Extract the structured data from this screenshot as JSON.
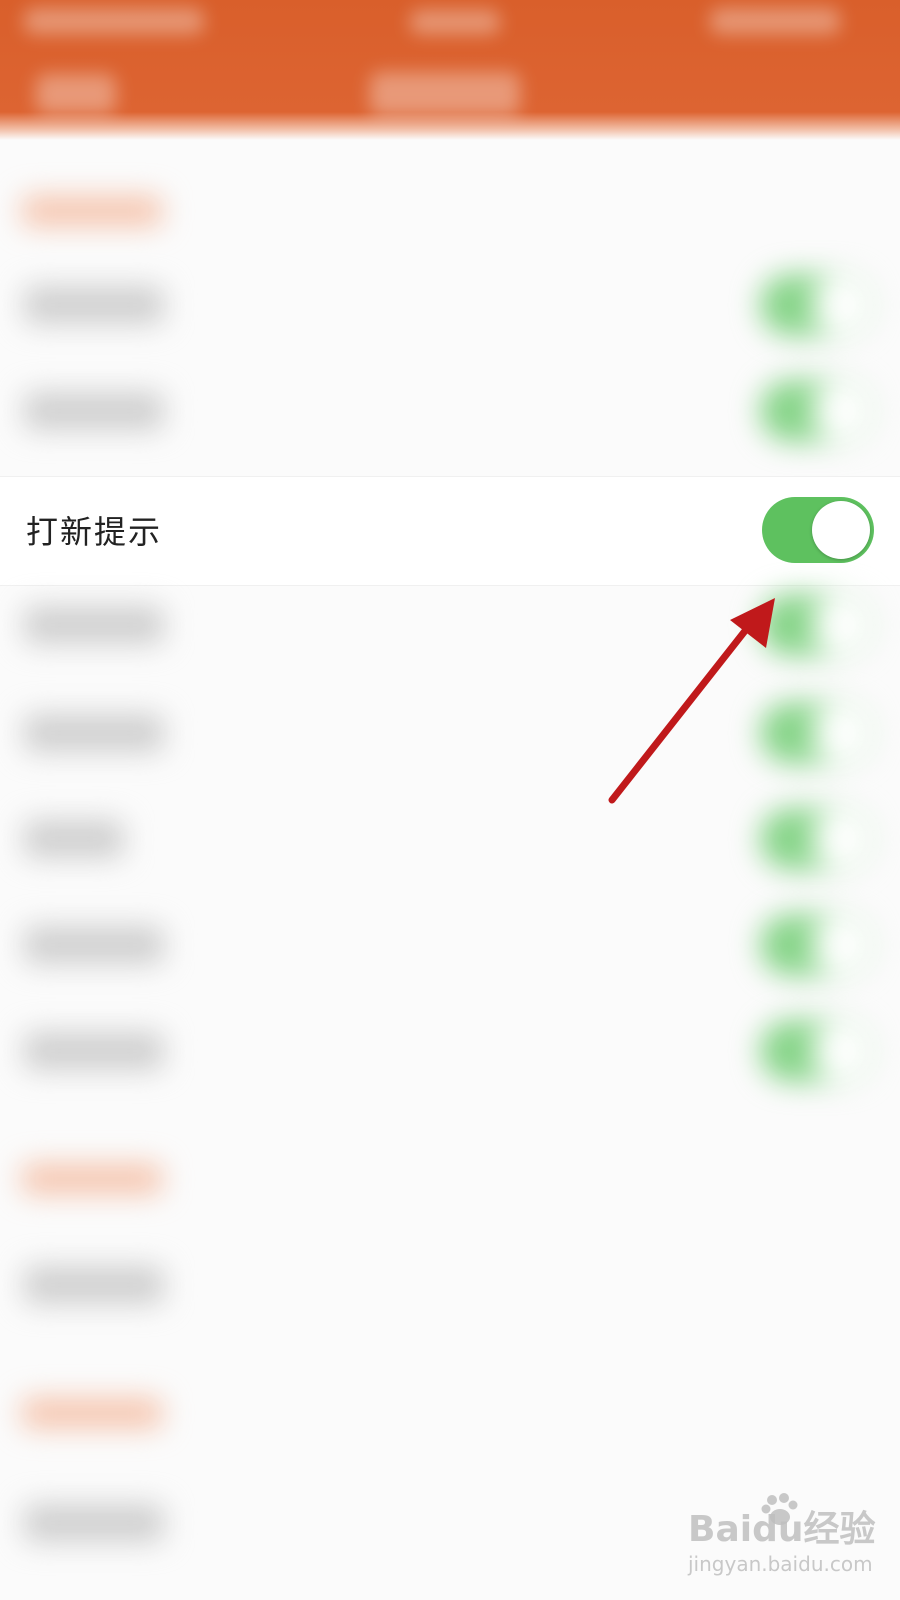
{
  "settings": {
    "focused_row": {
      "label": "打新提示",
      "toggle_on": true
    }
  },
  "colors": {
    "header": "#d95f2b",
    "toggle_on": "#5ec15f",
    "annotation_arrow": "#c0191b"
  },
  "watermark": {
    "brand": "Baidu经验",
    "url": "jingyan.baidu.com"
  }
}
